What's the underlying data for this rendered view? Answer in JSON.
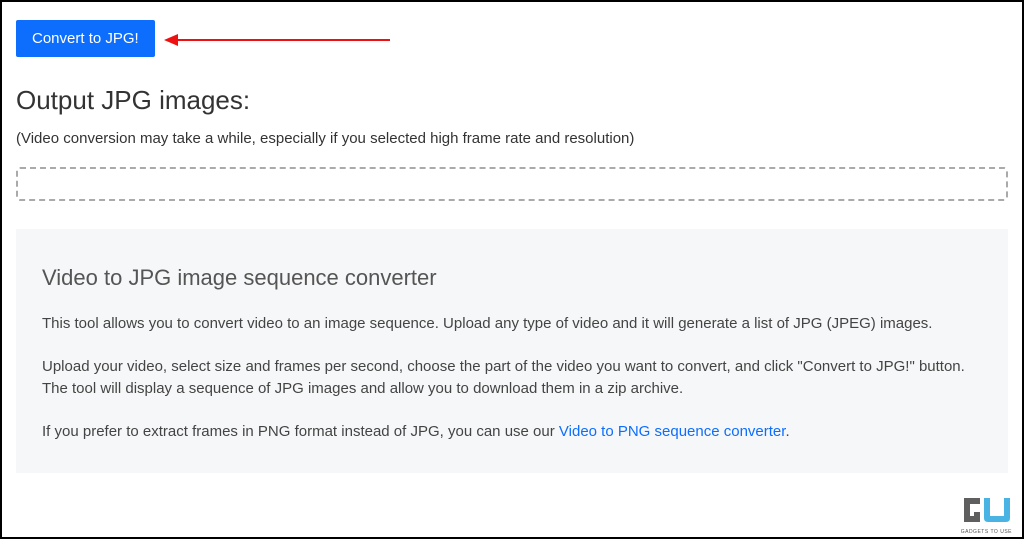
{
  "button": {
    "convert_label": "Convert to JPG!"
  },
  "output": {
    "heading": "Output JPG images:",
    "note": "(Video conversion may take a while, especially if you selected high frame rate and resolution)"
  },
  "info": {
    "title": "Video to JPG image sequence converter",
    "p1": "This tool allows you to convert video to an image sequence. Upload any type of video and it will generate a list of JPG (JPEG) images.",
    "p2": "Upload your video, select size and frames per second, choose the part of the video you want to convert, and click \"Convert to JPG!\" button. The tool will display a sequence of JPG images and allow you to download them in a zip archive.",
    "p3_prefix": "If you prefer to extract frames in PNG format instead of JPG, you can use our ",
    "p3_link": "Video to PNG sequence converter",
    "p3_suffix": "."
  },
  "watermark": {
    "text": "GADGETS TO USE"
  },
  "colors": {
    "primary": "#0d6efd",
    "arrow": "#e11"
  }
}
